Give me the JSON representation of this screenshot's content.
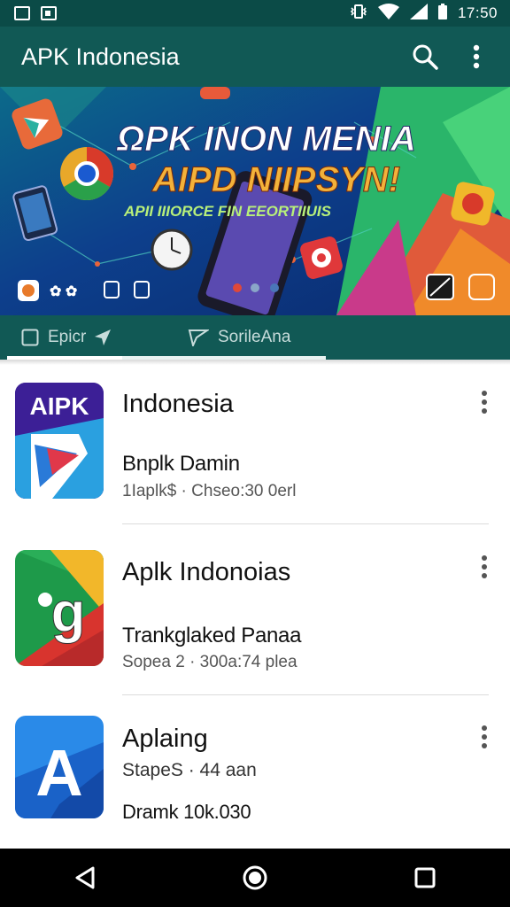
{
  "status_bar": {
    "time": "17:50",
    "icons": [
      "notification-icon",
      "screenshot-icon",
      "vibrate-icon",
      "wifi-icon",
      "signal-icon",
      "battery-icon"
    ]
  },
  "app_bar": {
    "title": "APK Indonesia",
    "icons": [
      "search-icon",
      "more-vert-icon"
    ],
    "color": "#115955"
  },
  "banner": {
    "headline_1": "ΩPK INON MENIA",
    "headline_2": "AIPD NIIPSYN!",
    "tagline": "APII ΙΙΙORCE FIN EEORTIIUIS",
    "carousel": {
      "pages": 3,
      "current": 1
    }
  },
  "tabs": [
    {
      "label": "Epicr",
      "icon": "checkbox-icon"
    },
    {
      "label": "SorileAna",
      "icon": "flag-icon"
    }
  ],
  "apps": [
    {
      "title": "Indonesia",
      "icon_text": "AIPK",
      "subtitle": "Bnplk Damin",
      "meta": "1Iaplk$ · Chseo:30 0erl"
    },
    {
      "title": "Aplk Indonoias",
      "icon_text": "g",
      "subtitle": "Trankglaked Panaa",
      "meta": "Sopea 2 · 300a:74 plea"
    },
    {
      "title": "Aplaing",
      "icon_text": "A",
      "subtitle": "StapeS · 44 aan",
      "meta": "Dramk 10k.030"
    }
  ],
  "nav_bar": {
    "buttons": [
      "back-icon",
      "home-icon",
      "recents-icon"
    ]
  }
}
